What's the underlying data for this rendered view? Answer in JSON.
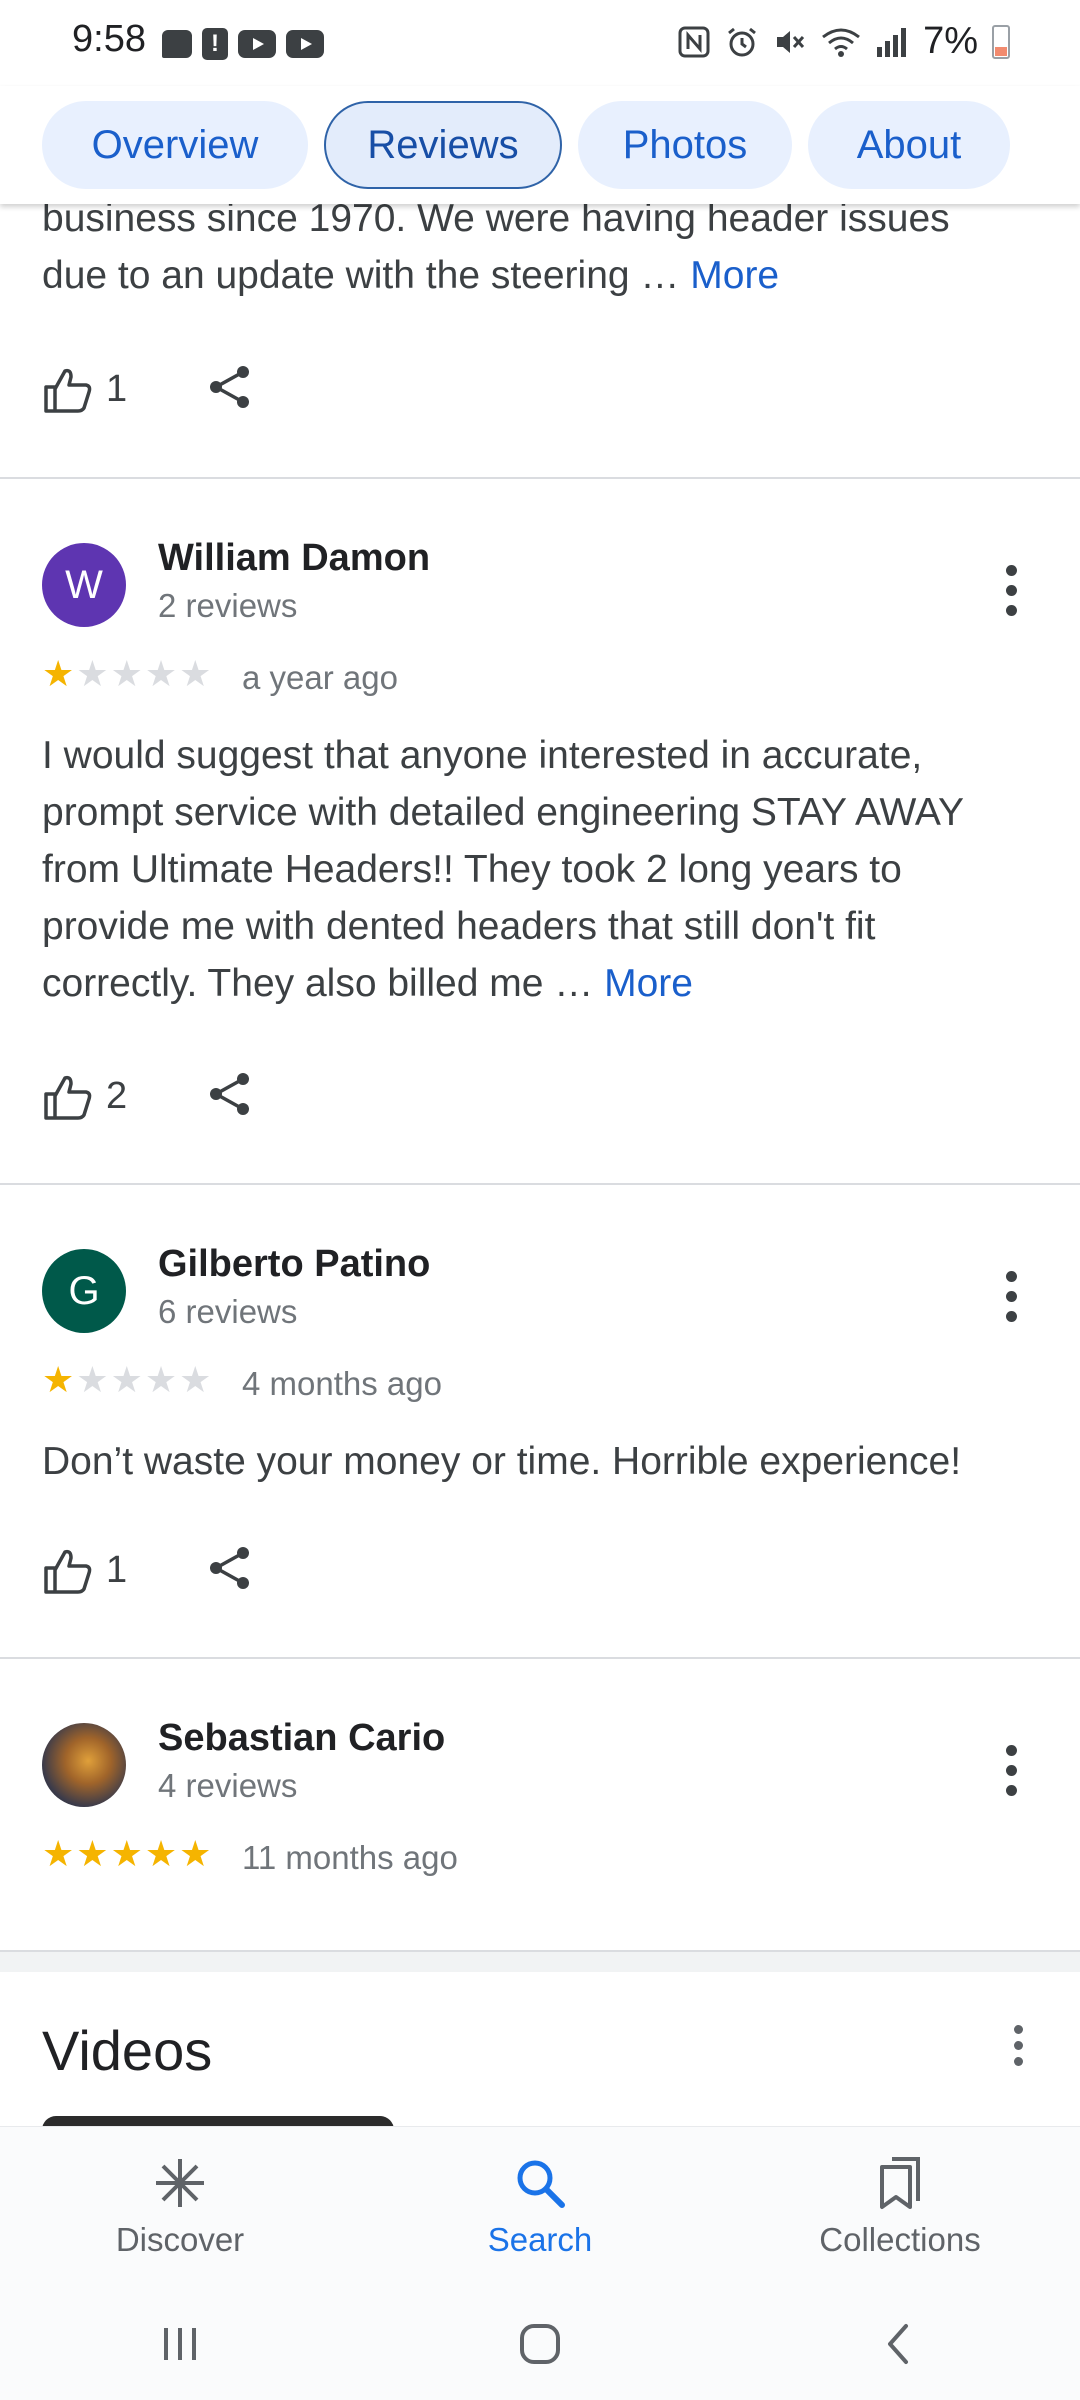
{
  "status_bar": {
    "time": "9:58",
    "battery": "7%",
    "left_icons": [
      "message-icon",
      "alert-icon",
      "youtube-icon",
      "youtube-icon"
    ],
    "right_icons": [
      "nfc-icon",
      "alarm-icon",
      "mute-icon",
      "wifi-icon",
      "signal-icon",
      "battery-icon"
    ]
  },
  "tabs": [
    {
      "label": "Overview",
      "active": false
    },
    {
      "label": "Reviews",
      "active": true
    },
    {
      "label": "Photos",
      "active": false
    },
    {
      "label": "About",
      "active": false
    }
  ],
  "partial_review": {
    "text_line1": "business since 1970. We were having header issues",
    "text_line2": "due to an update with the steering … ",
    "more": "More",
    "likes": "1"
  },
  "reviews": [
    {
      "avatar_letter": "W",
      "avatar_color": "#5e35b1",
      "name": "William Damon",
      "count": "2 reviews",
      "rating": 1,
      "date": "a year ago",
      "text_lines": [
        "I would suggest that anyone interested in accurate,",
        "prompt service with detailed engineering STAY AWAY",
        "from Ultimate Headers!! They took 2 long years to",
        "provide me with dented headers that still don't fit",
        "correctly. They also billed me … "
      ],
      "more": "More",
      "likes": "2"
    },
    {
      "avatar_letter": "G",
      "avatar_color": "#00594a",
      "name": "Gilberto Patino",
      "count": "6 reviews",
      "rating": 1,
      "date": "4 months ago",
      "text": "Don’t waste your money or time. Horrible experience!",
      "likes": "1"
    },
    {
      "name": "Sebastian Cario",
      "count": "4 reviews",
      "rating": 5,
      "date": "11 months ago"
    }
  ],
  "videos": {
    "title": "Videos"
  },
  "bottom_nav": [
    {
      "label": "Discover",
      "icon": "asterisk-icon",
      "active": false
    },
    {
      "label": "Search",
      "icon": "search-icon",
      "active": true
    },
    {
      "label": "Collections",
      "icon": "bookmarks-icon",
      "active": false
    }
  ],
  "colors": {
    "accent": "#1a73e8",
    "star": "#f5b400",
    "link": "#1a5fcb"
  }
}
